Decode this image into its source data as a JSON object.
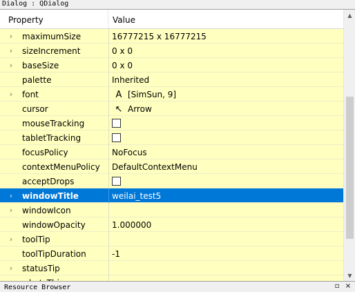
{
  "window": {
    "title": "Dialog : QDialog"
  },
  "header": {
    "property_label": "Property",
    "value_label": "Value"
  },
  "rows": [
    {
      "name": "maximumSize",
      "value": "16777215 x 16777215",
      "expandable": true
    },
    {
      "name": "sizeIncrement",
      "value": "0 x 0",
      "expandable": true
    },
    {
      "name": "baseSize",
      "value": "0 x 0",
      "expandable": true
    },
    {
      "name": "palette",
      "value": "Inherited",
      "expandable": false
    },
    {
      "name": "font",
      "value": "[SimSun, 9]",
      "expandable": true,
      "icon": "font-icon",
      "icon_glyph": "A"
    },
    {
      "name": "cursor",
      "value": "Arrow",
      "expandable": false,
      "icon": "arrow-cursor-icon",
      "icon_glyph": "↖"
    },
    {
      "name": "mouseTracking",
      "value": "",
      "expandable": false,
      "checkbox": true,
      "checked": false
    },
    {
      "name": "tabletTracking",
      "value": "",
      "expandable": false,
      "checkbox": true,
      "checked": false
    },
    {
      "name": "focusPolicy",
      "value": "NoFocus",
      "expandable": false
    },
    {
      "name": "contextMenuPolicy",
      "value": "DefaultContextMenu",
      "expandable": false
    },
    {
      "name": "acceptDrops",
      "value": "",
      "expandable": false,
      "checkbox": true,
      "checked": false
    },
    {
      "name": "windowTitle",
      "value": "weilai_test5",
      "expandable": true,
      "selected": true,
      "bold": true
    },
    {
      "name": "windowIcon",
      "value": "",
      "expandable": true
    },
    {
      "name": "windowOpacity",
      "value": "1.000000",
      "expandable": false
    },
    {
      "name": "toolTip",
      "value": "",
      "expandable": true
    },
    {
      "name": "toolTipDuration",
      "value": "-1",
      "expandable": false
    },
    {
      "name": "statusTip",
      "value": "",
      "expandable": true
    },
    {
      "name": "whatsThis",
      "value": "",
      "expandable": true
    }
  ],
  "bottom_dock": {
    "title": "Resource Browser"
  },
  "colors": {
    "row_background": "#ffffbf",
    "selected_background": "#0078d7",
    "selected_text": "#ffffff"
  }
}
